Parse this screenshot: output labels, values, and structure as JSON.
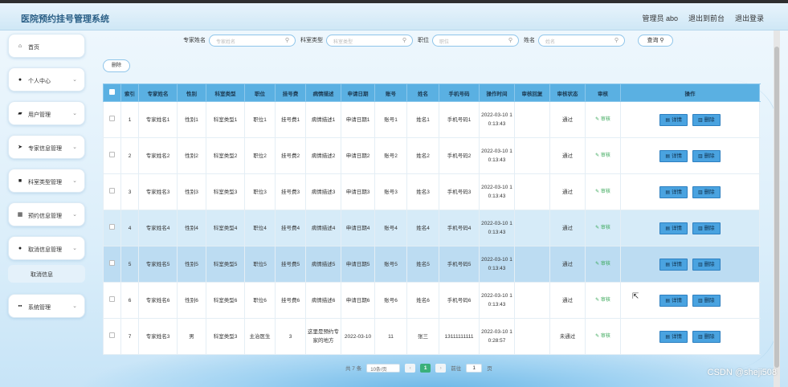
{
  "header": {
    "title": "医院预约挂号管理系统",
    "nav": [
      "管理员 abo",
      "退出到前台",
      "退出登录"
    ]
  },
  "sidebar": {
    "items": [
      {
        "label": "首页",
        "icon": "home-icon",
        "glyph": "⌂",
        "arrow": false
      },
      {
        "label": "个人中心",
        "icon": "user-icon",
        "glyph": "●",
        "arrow": true
      },
      {
        "label": "用户管理",
        "icon": "thumb-icon",
        "glyph": "▰",
        "arrow": true
      },
      {
        "label": "专家信息管理",
        "icon": "send-icon",
        "glyph": "➤",
        "arrow": true
      },
      {
        "label": "科室类型管理",
        "icon": "folder-icon",
        "glyph": "■",
        "arrow": true
      },
      {
        "label": "预约信息管理",
        "icon": "grid-icon",
        "glyph": "▦",
        "arrow": true
      },
      {
        "label": "取消信息管理",
        "icon": "pin-icon",
        "glyph": "●",
        "arrow": true
      },
      {
        "label": "系统管理",
        "icon": "apps-icon",
        "glyph": "▪▪",
        "arrow": true
      }
    ],
    "submenu": "取消信息"
  },
  "search": {
    "fields": [
      {
        "label": "专家姓名",
        "placeholder": "专家姓名"
      },
      {
        "label": "科室类型",
        "placeholder": "科室类型"
      },
      {
        "label": "职位",
        "placeholder": "职位"
      },
      {
        "label": "姓名",
        "placeholder": "姓名"
      }
    ],
    "button": "查询"
  },
  "toolbar": {
    "delete_label": "删除"
  },
  "table": {
    "headers": [
      "索引",
      "专家姓名",
      "性别",
      "科室类型",
      "职位",
      "挂号费",
      "病情描述",
      "申请日期",
      "账号",
      "姓名",
      "手机号码",
      "操作时间",
      "审核回复",
      "审核状态",
      "审核",
      "操作"
    ],
    "audit_label": "✎ 审核",
    "detail_label": "详情",
    "delete_label": "删除",
    "rows": [
      {
        "cells": [
          "1",
          "专家姓名1",
          "性别1",
          "科室类型1",
          "职位1",
          "挂号费1",
          "病情描述1",
          "申请日期1",
          "账号1",
          "姓名1",
          "手机号码1",
          "2022-03-10 10:13:43",
          "",
          "通过"
        ],
        "style": "r-white"
      },
      {
        "cells": [
          "2",
          "专家姓名2",
          "性别2",
          "科室类型2",
          "职位2",
          "挂号费2",
          "病情描述2",
          "申请日期2",
          "账号2",
          "姓名2",
          "手机号码2",
          "2022-03-10 10:13:43",
          "",
          "通过"
        ],
        "style": "r-white"
      },
      {
        "cells": [
          "3",
          "专家姓名3",
          "性别3",
          "科室类型3",
          "职位3",
          "挂号费3",
          "病情描述3",
          "申请日期3",
          "账号3",
          "姓名3",
          "手机号码3",
          "2022-03-10 10:13:43",
          "",
          "通过"
        ],
        "style": "r-white"
      },
      {
        "cells": [
          "4",
          "专家姓名4",
          "性别4",
          "科室类型4",
          "职位4",
          "挂号费4",
          "病情描述4",
          "申请日期4",
          "账号4",
          "姓名4",
          "手机号码4",
          "2022-03-10 10:13:43",
          "",
          "通过"
        ],
        "style": "r-hi"
      },
      {
        "cells": [
          "5",
          "专家姓名5",
          "性别5",
          "科室类型5",
          "职位5",
          "挂号费5",
          "病情描述5",
          "申请日期5",
          "账号5",
          "姓名5",
          "手机号码5",
          "2022-03-10 10:13:43",
          "",
          "通过"
        ],
        "style": "r-sel"
      },
      {
        "cells": [
          "6",
          "专家姓名6",
          "性别6",
          "科室类型6",
          "职位6",
          "挂号费6",
          "病情描述6",
          "申请日期6",
          "账号6",
          "姓名6",
          "手机号码6",
          "2022-03-10 10:13:43",
          "",
          "通过"
        ],
        "style": "r-white"
      },
      {
        "cells": [
          "7",
          "专家姓名3",
          "男",
          "科室类型3",
          "主治医生",
          "3",
          "这里是预约专家的地方",
          "2022-03-10",
          "11",
          "张三",
          "13111111111",
          "2022-03-10 10:28:57",
          "",
          "未通过"
        ],
        "style": "r-white"
      }
    ]
  },
  "pager": {
    "total": "共 7 条",
    "page_size": "10条/页",
    "prev": "‹",
    "current": "1",
    "next": "›",
    "goto_label": "前往",
    "goto_value": "1",
    "goto_suffix": "页"
  },
  "watermark": "CSDN @sheji508"
}
